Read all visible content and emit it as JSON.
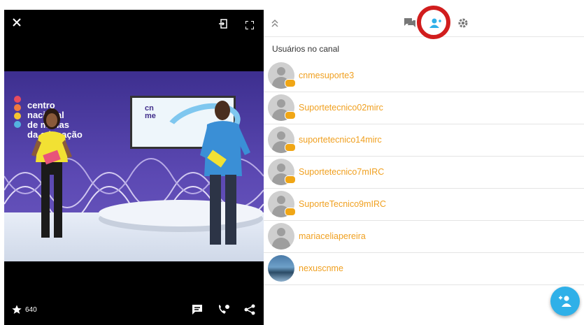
{
  "video": {
    "likes_count": "640",
    "studio_brand_lines": [
      "centro",
      "nacional",
      "de mídias",
      "da educação"
    ],
    "screen_logo": [
      "cn",
      "me"
    ]
  },
  "panel": {
    "section_title": "Usuários no canal",
    "users": [
      {
        "name": "cnmesuporte3",
        "avatar": "default-avatar",
        "badge": true
      },
      {
        "name": "Suportetecnico02mirc",
        "avatar": "default-avatar",
        "badge": true
      },
      {
        "name": "suportetecnico14mirc",
        "avatar": "default-avatar",
        "badge": true
      },
      {
        "name": "Suportetecnico7mIRC",
        "avatar": "default-avatar",
        "badge": true
      },
      {
        "name": "SuporteTecnico9mIRC",
        "avatar": "default-avatar",
        "badge": true
      },
      {
        "name": "mariaceliapereira",
        "avatar": "default-avatar",
        "badge": false
      },
      {
        "name": "nexuscnme",
        "avatar": "photo",
        "badge": false
      }
    ]
  },
  "colors": {
    "username": "#f0a020",
    "accent": "#2fb0e8",
    "highlight_ring": "#d11d1d",
    "badge": "#f0a616"
  },
  "icons": [
    "close-icon",
    "exit-icon",
    "fullscreen-icon",
    "star-icon",
    "chat-icon",
    "call-icon",
    "share-icon",
    "collapse-icon",
    "chat-tab-icon",
    "users-tab-icon",
    "settings-icon",
    "add-user-icon"
  ]
}
